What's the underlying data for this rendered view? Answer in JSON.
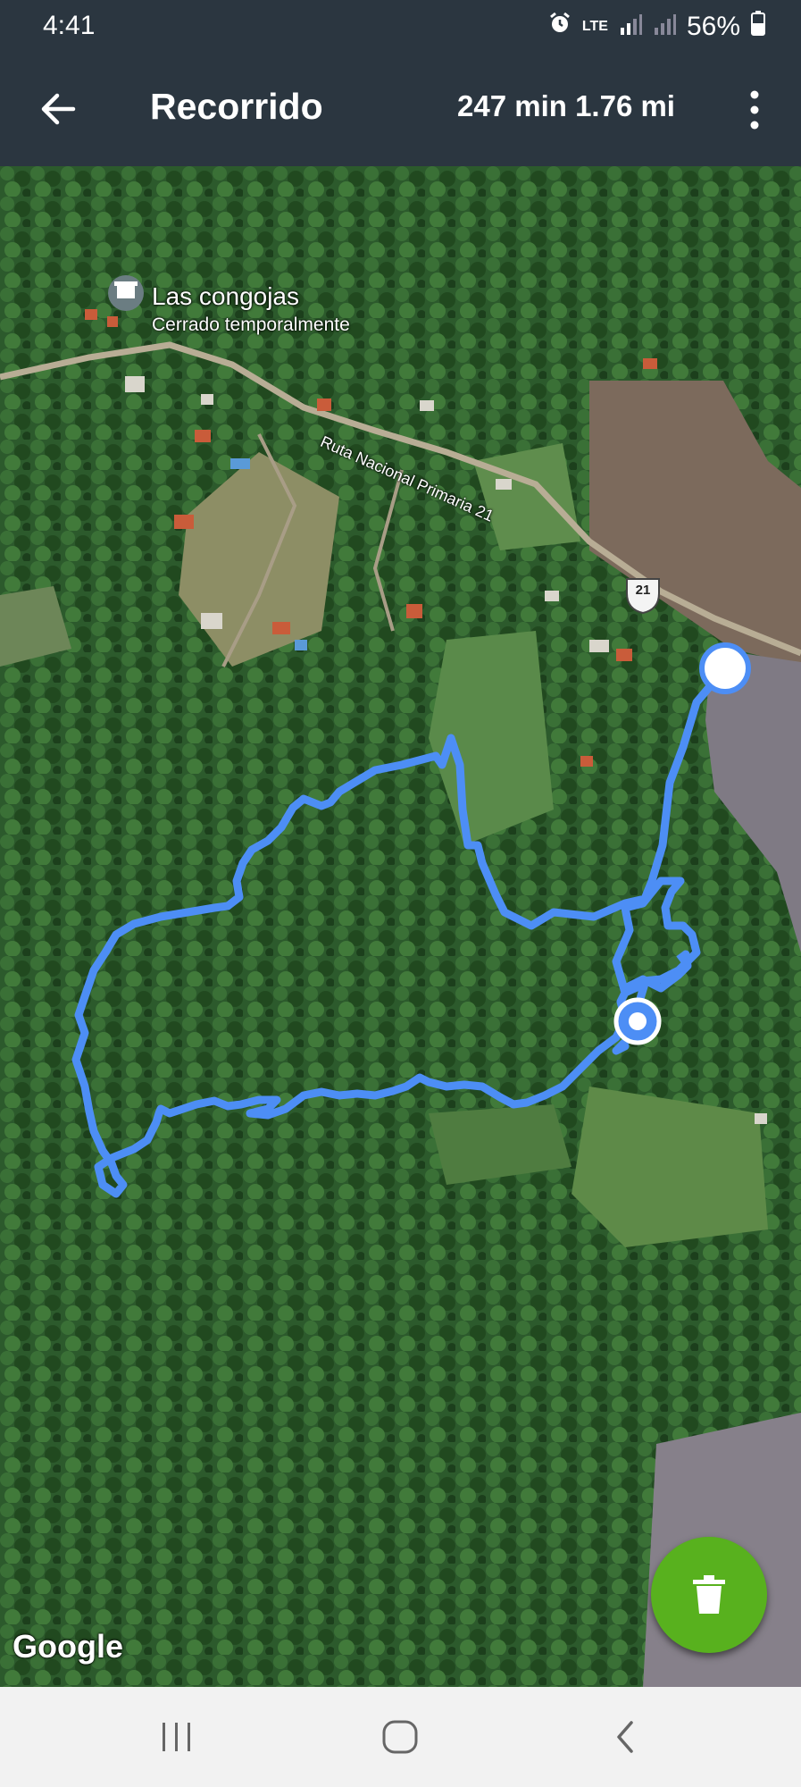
{
  "status_bar": {
    "time": "4:41",
    "network": "LTE",
    "battery": "56%",
    "icons": [
      "alarm-icon",
      "lte-icon",
      "signal-icon",
      "signal-icon",
      "battery-icon"
    ]
  },
  "app_bar": {
    "title": "Recorrido",
    "stats": "247 min 1.76 mi",
    "back_icon": "arrow-left-icon",
    "menu_icon": "more-vert-icon"
  },
  "map": {
    "poi_name": "Las congojas",
    "poi_status": "Cerrado temporalmente",
    "road_label": "Ruta Nacional Primaria 21",
    "road_shield": "21",
    "attribution": "Google",
    "route_color": "#4d8ef5"
  },
  "fab": {
    "icon": "trash-icon",
    "color": "#58b11e"
  },
  "nav_bar": {
    "icons": [
      "recents-icon",
      "home-icon",
      "back-icon"
    ]
  }
}
